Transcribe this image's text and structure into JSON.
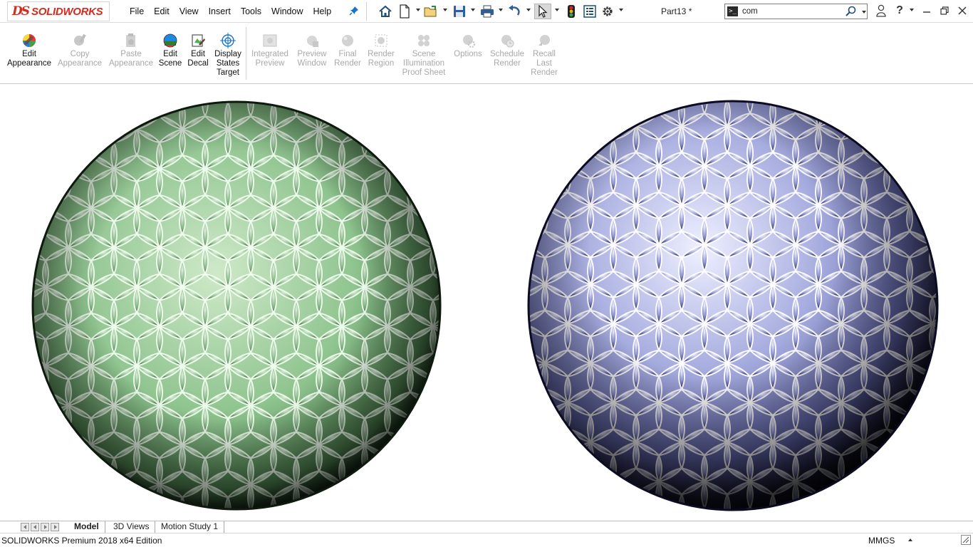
{
  "app": {
    "brand_mark": "DS",
    "brand_name": "SOLIDWORKS",
    "document_title": "Part13 *"
  },
  "menu": [
    "File",
    "Edit",
    "View",
    "Insert",
    "Tools",
    "Window",
    "Help"
  ],
  "quick_access_icons": [
    "home-icon",
    "new-document-icon",
    "open-icon",
    "save-icon",
    "print-icon",
    "undo-icon",
    "select-pointer-icon",
    "rebuild-icon",
    "file-properties-icon",
    "options-gear-icon"
  ],
  "search": {
    "value": "com",
    "command_glyph": ">_"
  },
  "ribbon": {
    "buttons": [
      {
        "label": [
          "Edit",
          "Appearance"
        ],
        "enabled": true,
        "icon": "appearance-sphere-icon"
      },
      {
        "label": [
          "Copy",
          "Appearance"
        ],
        "enabled": false,
        "icon": "copy-appearance-icon"
      },
      {
        "label": [
          "Paste",
          "Appearance"
        ],
        "enabled": false,
        "icon": "paste-appearance-icon"
      },
      {
        "label": [
          "Edit",
          "Scene"
        ],
        "enabled": true,
        "icon": "scene-icon"
      },
      {
        "label": [
          "Edit",
          "Decal"
        ],
        "enabled": true,
        "icon": "decal-icon"
      },
      {
        "label": [
          "Display",
          "States",
          "Target"
        ],
        "enabled": true,
        "icon": "display-states-target-icon"
      },
      {
        "label": [
          "Integrated",
          "Preview"
        ],
        "enabled": false,
        "icon": "integrated-preview-icon"
      },
      {
        "label": [
          "Preview",
          "Window"
        ],
        "enabled": false,
        "icon": "preview-window-icon"
      },
      {
        "label": [
          "Final",
          "Render"
        ],
        "enabled": false,
        "icon": "final-render-icon"
      },
      {
        "label": [
          "Render",
          "Region"
        ],
        "enabled": false,
        "icon": "render-region-icon"
      },
      {
        "label": [
          "Scene",
          "Illumination",
          "Proof Sheet"
        ],
        "enabled": false,
        "icon": "scene-illumination-icon"
      },
      {
        "label": [
          "Options"
        ],
        "enabled": false,
        "icon": "render-options-icon"
      },
      {
        "label": [
          "Schedule",
          "Render"
        ],
        "enabled": false,
        "icon": "schedule-render-icon"
      },
      {
        "label": [
          "Recall",
          "Last",
          "Render"
        ],
        "enabled": false,
        "icon": "recall-render-icon"
      }
    ]
  },
  "viewport": {
    "models": [
      {
        "name": "green-textured-sphere",
        "base_color": "#8fc48f",
        "dark_color": "#0c1a0c",
        "highlight_color": "#e6f7e3"
      },
      {
        "name": "blue-chrome-textured-sphere",
        "base_color": "#8a8fd0",
        "dark_color": "#08081a",
        "highlight_color": "#eef0ff"
      }
    ]
  },
  "tabs": [
    {
      "label": "Model",
      "active": true
    },
    {
      "label": "3D Views",
      "active": false
    },
    {
      "label": "Motion Study 1",
      "active": false
    }
  ],
  "status": {
    "text": "SOLIDWORKS Premium 2018 x64 Edition",
    "units": "MMGS"
  },
  "colors": {
    "brand_red": "#d52b1e",
    "accent_blue": "#1a73c9"
  }
}
